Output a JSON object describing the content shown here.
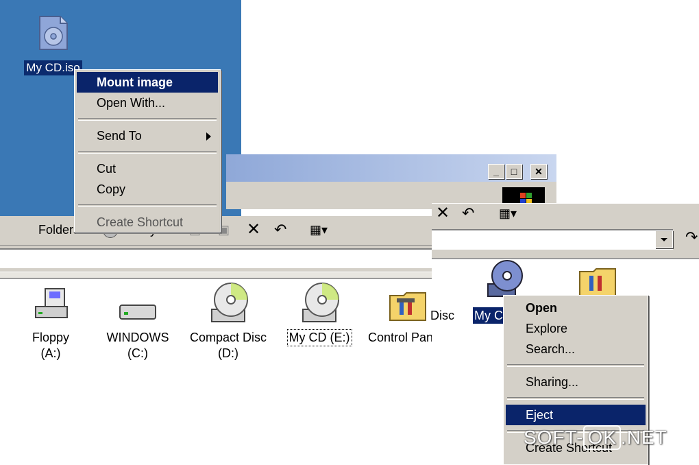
{
  "desktop": {
    "icon_label": "My CD.iso"
  },
  "menu1": {
    "items": [
      {
        "label": "Mount image"
      },
      {
        "label": "Open With..."
      },
      {
        "label": "Send To"
      },
      {
        "label": "Cut"
      },
      {
        "label": "Copy"
      },
      {
        "label": "Create Shortcut"
      }
    ]
  },
  "window1": {
    "toolbar": {
      "folders": "Folders",
      "history": "History"
    },
    "drives": [
      {
        "label": "Floppy",
        "sub": "(A:)"
      },
      {
        "label": "WINDOWS",
        "sub": "(C:)"
      },
      {
        "label": "Compact Disc",
        "sub": "(D:)"
      },
      {
        "label": "My CD (E:)",
        "sub": ""
      },
      {
        "label": "Control Panel",
        "sub": ""
      }
    ]
  },
  "window2": {
    "disc_fragment": "Disc",
    "selected_label": "My C"
  },
  "menu2": {
    "items": [
      {
        "label": "Open"
      },
      {
        "label": "Explore"
      },
      {
        "label": "Search..."
      },
      {
        "label": "Sharing..."
      },
      {
        "label": "Eject"
      },
      {
        "label": "Create Shortcut"
      }
    ]
  },
  "watermark": {
    "left": "SOFT-",
    "box": "OK",
    "right": ".NET"
  },
  "colors": {
    "desktop": "#3a78b5",
    "selection": "#0a246a",
    "face": "#d4d0c8"
  }
}
